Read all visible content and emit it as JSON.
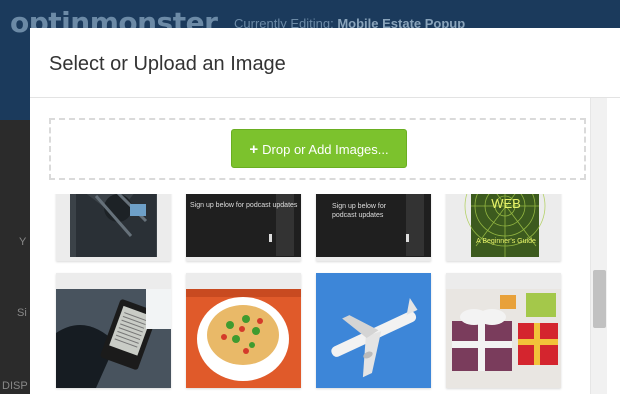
{
  "app": {
    "logo": "optinmonster",
    "editing_label": "Currently Editing:",
    "editing_name": "Mobile Estate Popup",
    "left_labels": [
      "Y",
      "Si",
      "DISP"
    ]
  },
  "modal": {
    "title": "Select or Upload an Image",
    "add_button_label": "Drop or Add Images..."
  },
  "thumbnails": {
    "row1": [
      {
        "icon": "dark-abstract-image"
      },
      {
        "icon": "podcast-promo-image",
        "caption": "Sign up below for podcast updates"
      },
      {
        "icon": "podcast-promo-image",
        "caption": "Sign up below for podcast updates"
      },
      {
        "icon": "web-ebook-cover-image",
        "title": "WEB",
        "subtitle": "A Beginner's Guide"
      }
    ],
    "row2": [
      {
        "icon": "ereader-hand-image"
      },
      {
        "icon": "noodle-bowl-image"
      },
      {
        "icon": "airplane-sky-image"
      },
      {
        "icon": "gift-boxes-image"
      }
    ]
  },
  "colors": {
    "accent_green": "#7cc22d",
    "header_bg": "#1b3a5c",
    "sky_blue": "#3d86d8"
  }
}
